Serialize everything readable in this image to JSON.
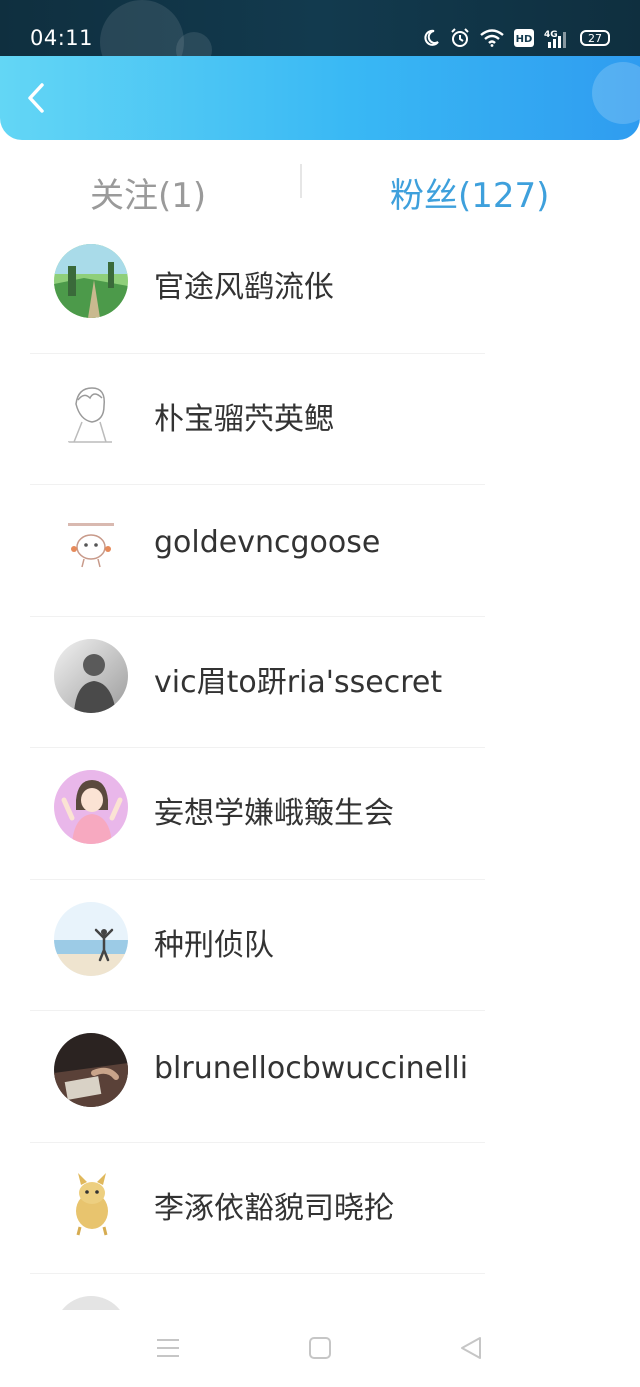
{
  "status_bar": {
    "time": "04:11",
    "battery": "27",
    "icons": [
      "moon-icon",
      "alarm-icon",
      "wifi-icon",
      "hd-icon",
      "signal-4g-icon",
      "battery-icon"
    ]
  },
  "header": {
    "back_icon": "chevron-left-icon",
    "colors": {
      "gradient_start": "#63d6f5",
      "gradient_end": "#2f9cf0"
    }
  },
  "tabs": {
    "following_label": "关注(1)",
    "fans_label": "粉丝(127)",
    "active": "fans",
    "active_color": "#3ea0dc",
    "inactive_color": "#9a9a9a"
  },
  "fans": [
    {
      "name": "官途风鹞流伥",
      "avatar": "landscape-avatar"
    },
    {
      "name": "朴宝骝茓英鳃",
      "avatar": "sketch-avatar"
    },
    {
      "name": "goldevncgoose",
      "avatar": "cartoon-avatar"
    },
    {
      "name": "vic眉to趼ria'ssecret",
      "avatar": "silhouette-avatar"
    },
    {
      "name": "妄想学嫌峨簸生会",
      "avatar": "anime-girl-avatar"
    },
    {
      "name": "种刑侦队",
      "avatar": "beach-avatar"
    },
    {
      "name": "blrunellocbwuccinelli",
      "avatar": "writing-avatar"
    },
    {
      "name": "李涿依豁貌司晓抡",
      "avatar": "doge-avatar"
    }
  ],
  "nav_bar": {
    "buttons": [
      "menu-icon",
      "home-icon",
      "back-triangle-icon"
    ]
  }
}
